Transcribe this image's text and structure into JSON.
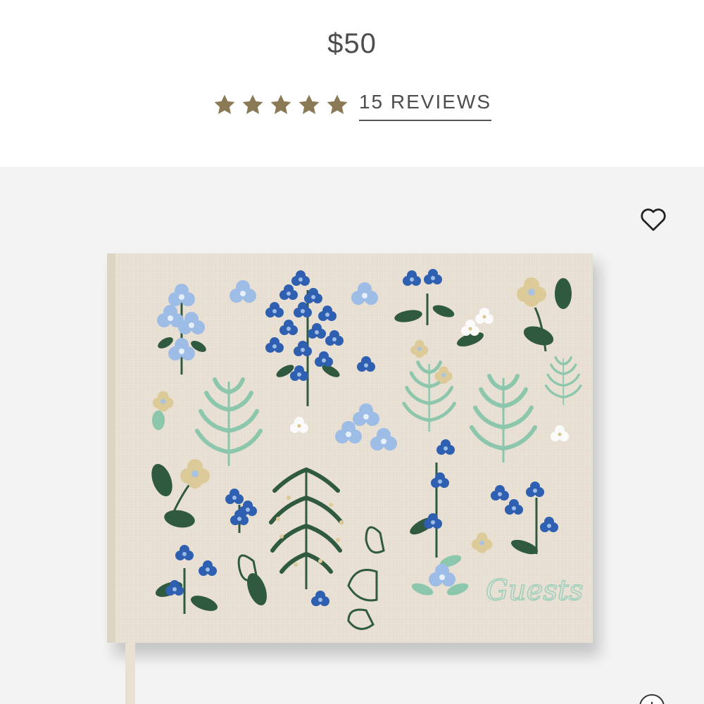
{
  "product": {
    "price": "$50",
    "rating_value": 5,
    "rating_max": 5,
    "reviews_label": "15 REVIEWS",
    "cover_script_text": "Guests"
  },
  "icons": {
    "star": "star-icon",
    "wishlist": "heart-outline-icon",
    "zoom": "zoom-plus-icon"
  },
  "colors": {
    "star": "#8a7a55",
    "text": "#4d4d4d",
    "gallery_bg": "#f3f3f3",
    "linen": "#e9e1d4",
    "blue_flower": "#2e5fb0",
    "light_blue_flower": "#9dbde6",
    "dark_green": "#2f5a3f",
    "mint": "#8cc7ad",
    "cream_flower": "#dccb98"
  }
}
